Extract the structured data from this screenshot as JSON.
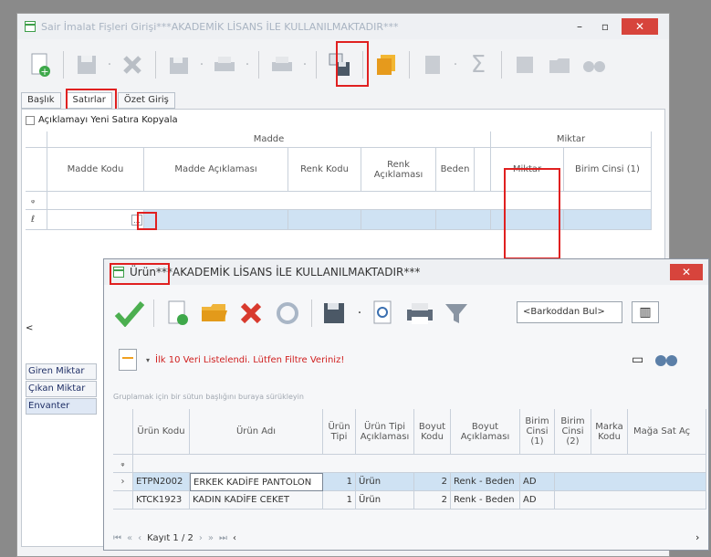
{
  "back_window": {
    "title": "Sair İmalat Fişleri Girişi***AKADEMİK LİSANS İLE KULLANILMAKTADIR***",
    "controls": {
      "minimize": "–",
      "maximize": "▫",
      "close": "✕"
    },
    "tabs": [
      "Başlık",
      "Satırlar",
      "Özet Giriş"
    ],
    "checkbox_label": "Açıklamayı Yeni Satıra Kopyala",
    "group_headers": {
      "madde": "Madde",
      "miktar": "Miktar"
    },
    "columns": [
      "Madde Kodu",
      "Madde Açıklaması",
      "Renk Kodu",
      "Renk Açıklaması",
      "Beden",
      "Miktar",
      "Birim Cinsi (1)"
    ],
    "row_markers": [
      "ᵩ",
      "ℓ"
    ],
    "lookup_button": "...",
    "scroll_left": "<",
    "side_labels": [
      "Giren Miktar",
      "Çıkan Miktar",
      "Envanter"
    ]
  },
  "front_window": {
    "title_prefix": "Ürün",
    "title_rest": "***AKADEMİK LİSANS İLE KULLANILMAKTADIR***",
    "close": "✕",
    "search_placeholder": "<Barkoddan Bul>",
    "filter_message": "İlk 10 Veri Listelendi. Lütfen Filtre Veriniz!",
    "group_hint": "Gruplamak için bir sütun başlığını buraya sürükleyin",
    "columns": [
      "Ürün Kodu",
      "Ürün Adı",
      "Ürün Tipi",
      "Ürün Tipi Açıklaması",
      "Boyut Kodu",
      "Boyut Açıklaması",
      "Birim Cinsi (1)",
      "Birim Cinsi (2)",
      "Marka Kodu",
      "Mağa Sat Aç"
    ],
    "rows": [
      {
        "kod": "ETPN2002",
        "ad": "ERKEK KADİFE PANTOLON",
        "tip": "1",
        "tip_aciklama": "Ürün",
        "boyut_kodu": "2",
        "boyut_aciklama": "Renk - Beden",
        "birim1": "AD"
      },
      {
        "kod": "KTCK1923",
        "ad": "KADIN KADİFE CEKET",
        "tip": "1",
        "tip_aciklama": "Ürün",
        "boyut_kodu": "2",
        "boyut_aciklama": "Renk - Beden",
        "birim1": "AD"
      }
    ],
    "navigator": {
      "label": "Kayıt 1 / 2"
    }
  },
  "colors": {
    "highlight_red": "#e02020",
    "row_blue": "#cfe2f3",
    "accent_green": "#4caf50"
  }
}
